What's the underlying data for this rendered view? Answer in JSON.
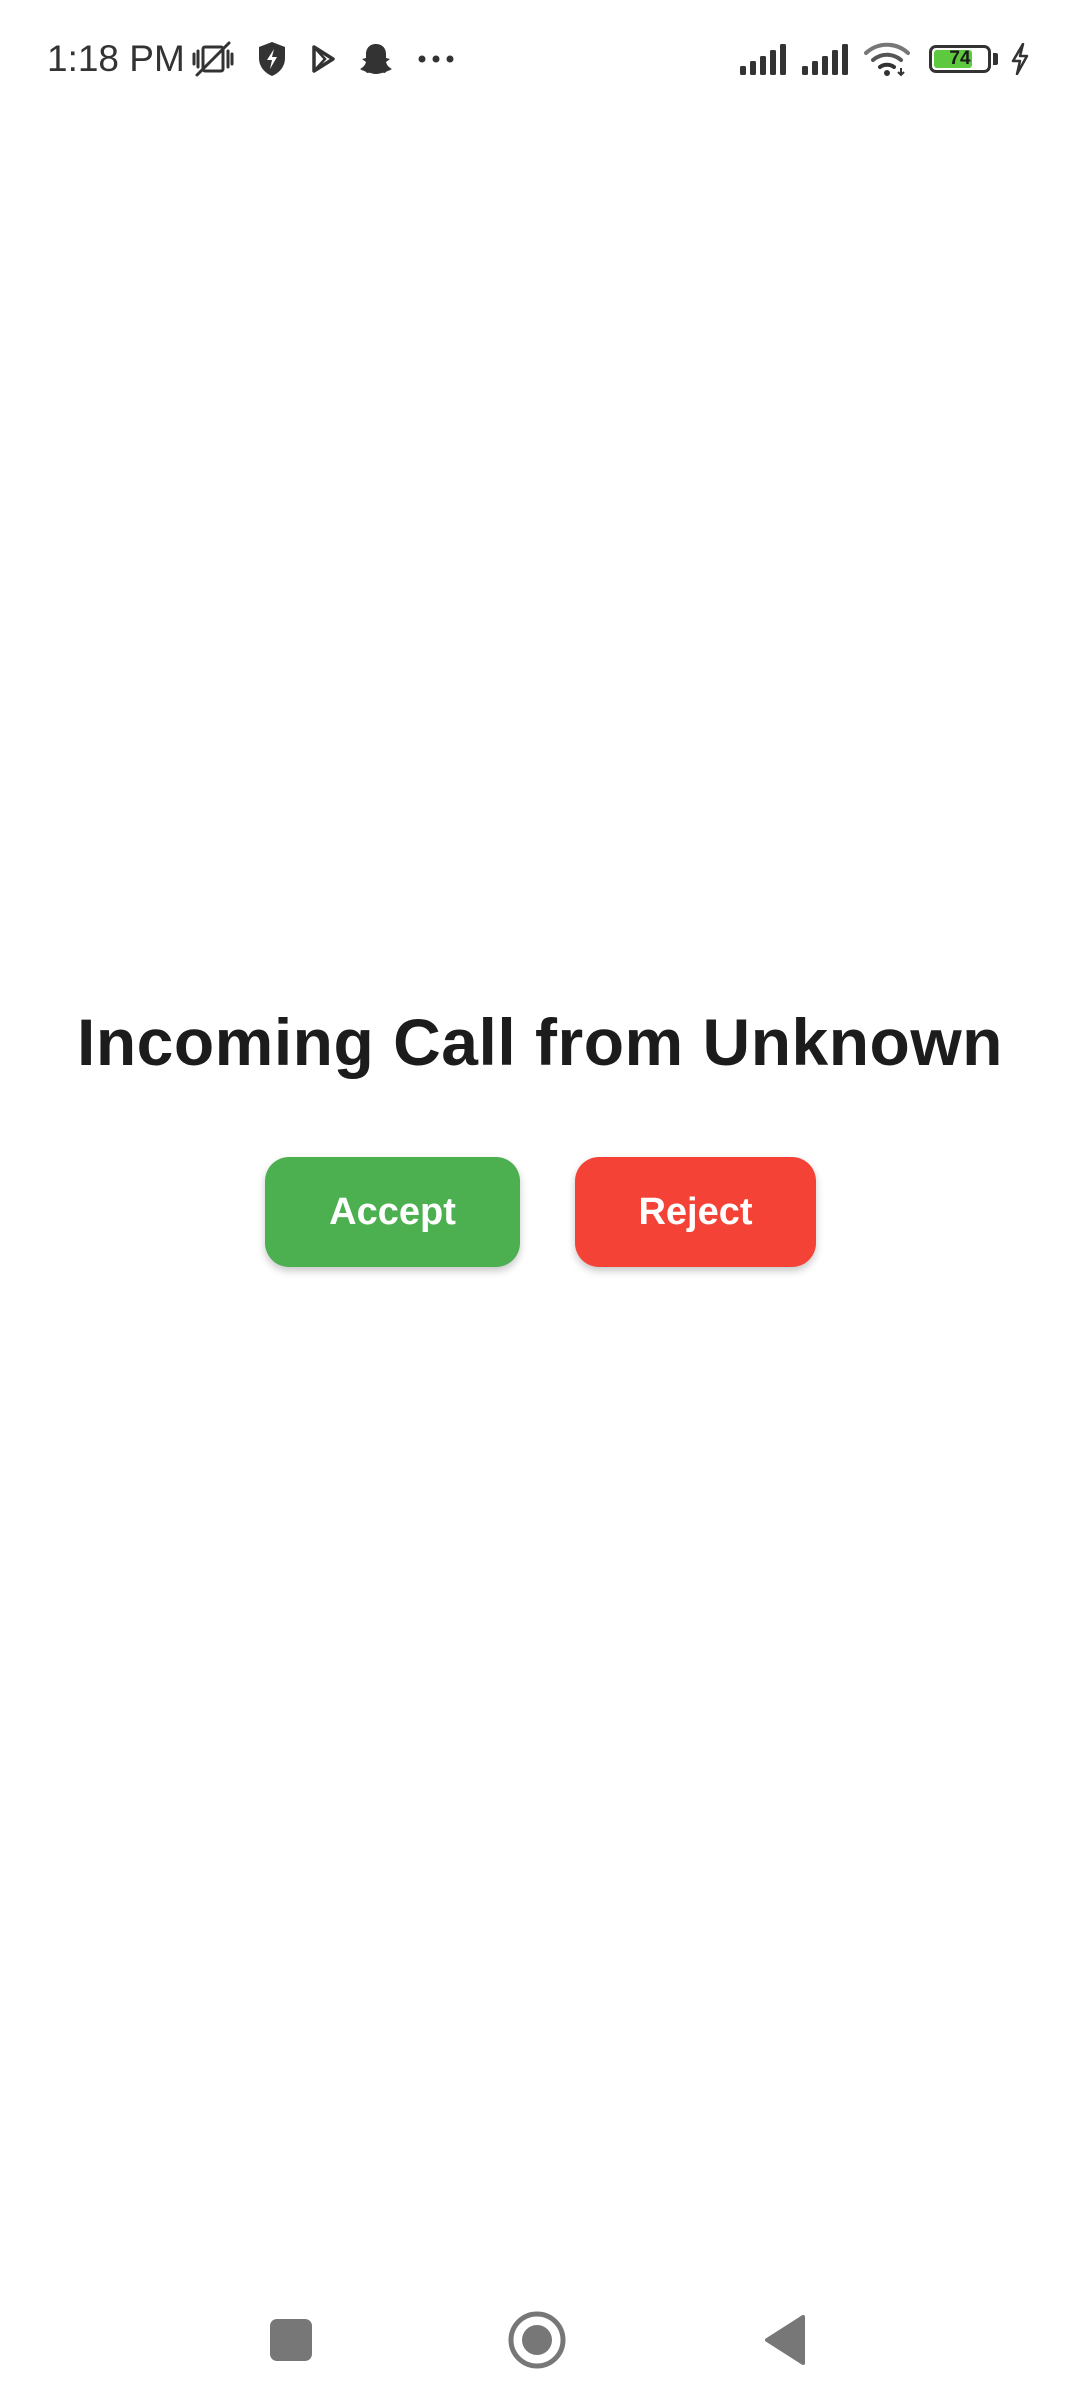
{
  "status_bar": {
    "time": "1:18 PM",
    "left_icons": [
      "vibrate-off-icon",
      "shield-icon",
      "play-store-icon",
      "snapchat-icon",
      "more-dots-icon"
    ],
    "right_icons": [
      "signal-icon",
      "signal-icon",
      "wifi-icon",
      "battery-icon",
      "charging-icon"
    ],
    "battery_level": "74",
    "battery_fraction": 0.74,
    "battery_color": "#5dc93f"
  },
  "call": {
    "title": "Incoming Call from Unknown",
    "accept_label": "Accept",
    "reject_label": "Reject",
    "accept_color": "#4caf50",
    "reject_color": "#f44336"
  },
  "nav_bar": {
    "icons": [
      "recents-square-icon",
      "home-circle-icon",
      "back-triangle-icon"
    ]
  }
}
